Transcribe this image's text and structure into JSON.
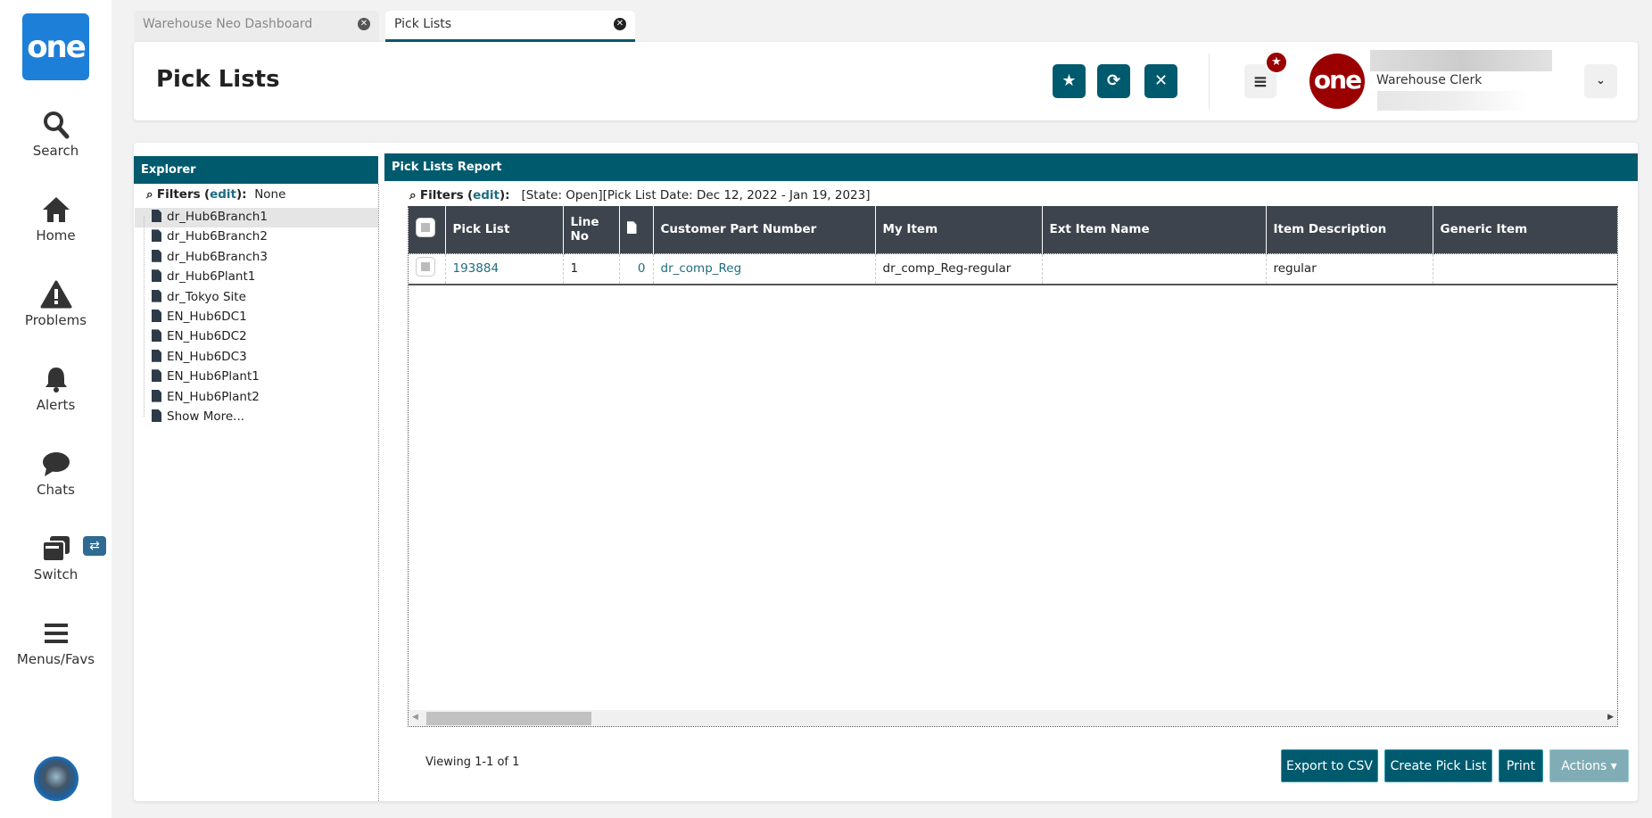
{
  "sidebar": {
    "logo": "one",
    "items": [
      {
        "label": "Search"
      },
      {
        "label": "Home"
      },
      {
        "label": "Problems"
      },
      {
        "label": "Alerts"
      },
      {
        "label": "Chats"
      },
      {
        "label": "Switch"
      },
      {
        "label": "Menus/Favs"
      }
    ]
  },
  "tabs": [
    {
      "label": "Warehouse Neo Dashboard",
      "active": false
    },
    {
      "label": "Pick Lists",
      "active": true
    }
  ],
  "header": {
    "title": "Pick Lists",
    "user_role": "Warehouse Clerk",
    "avatar_text": "one"
  },
  "explorer": {
    "title": "Explorer",
    "filters_label": "Filters",
    "edit": "edit",
    "filters_value": "None",
    "items": [
      "dr_Hub6Branch1",
      "dr_Hub6Branch2",
      "dr_Hub6Branch3",
      "dr_Hub6Plant1",
      "dr_Tokyo Site",
      "EN_Hub6DC1",
      "EN_Hub6DC2",
      "EN_Hub6DC3",
      "EN_Hub6Plant1",
      "EN_Hub6Plant2",
      "Show More..."
    ]
  },
  "report": {
    "title": "Pick Lists Report",
    "filters_label": "Filters",
    "edit": "edit",
    "filters_value": "[State: Open][Pick List Date: Dec 12, 2022 - Jan 19, 2023]",
    "columns": [
      "Pick List",
      "Line No",
      "",
      "Customer Part Number",
      "My Item",
      "Ext Item Name",
      "Item Description",
      "Generic Item"
    ],
    "rows": [
      {
        "pick_list": "193884",
        "line_no": "1",
        "docs": "0",
        "customer_part": "dr_comp_Reg",
        "my_item": "dr_comp_Reg-regular",
        "ext_item": "",
        "description": "regular",
        "generic": ""
      }
    ],
    "viewing": "Viewing 1-1 of 1",
    "buttons": {
      "export": "Export to CSV",
      "create": "Create Pick List",
      "print": "Print",
      "actions": "Actions ▾"
    }
  },
  "colors": {
    "teal": "#005a6e",
    "header_dark": "#3d444d",
    "brand_red": "#9b0000"
  }
}
